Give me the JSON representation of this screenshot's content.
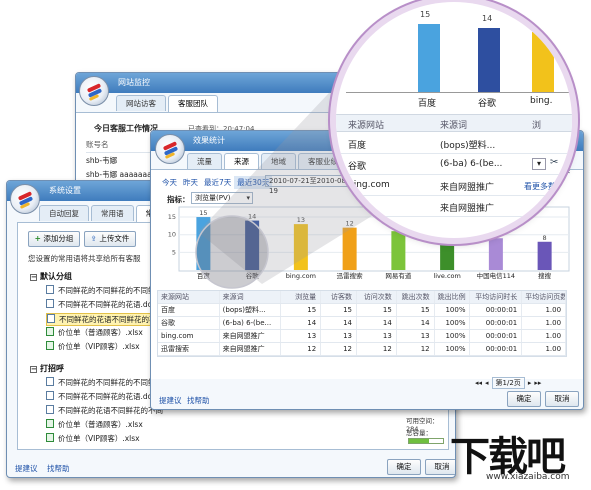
{
  "monitor": {
    "title": "网站监控",
    "tabs": [
      "网站访客",
      "客服团队"
    ],
    "heading": "今日客服工作情况",
    "stats_label": "已查看到：20:47:04",
    "col_label": "账号名",
    "rows": [
      "shb-韦娜",
      "shb-韦娜 aaaaaaaaaaaa"
    ]
  },
  "settings": {
    "title": "系统设置",
    "tabs": [
      "自动回复",
      "常用语",
      "常用文件"
    ],
    "add_group": "添加分组",
    "upload": "上传文件",
    "notice": "您设置的常用语将共享给所有客服",
    "groups": [
      {
        "name": "默认分组",
        "files": [
          "不同鲜花的不同鲜花的不同鲜",
          "不同鲜花不同鲜花的花语.docx",
          "不同鲜花的花语不同鲜花的不同",
          "价位单（普通顾客）.xlsx",
          "价位单（VIP顾客）.xlsx"
        ]
      },
      {
        "name": "打招呼",
        "files": [
          "不同鲜花的不同鲜花的不同鲜花",
          "不同鲜花不同鲜花的花语.docx",
          "不同鲜花的花语不同鲜花的不同",
          "价位单（普通顾客）.xlsx",
          "价位单（VIP顾客）.xlsx"
        ]
      }
    ],
    "usage_label": "可用空间：284",
    "capacity_label": "总容量：",
    "feedback": "提建议",
    "help": "找帮助",
    "ok": "确定",
    "cancel": "取消"
  },
  "stats": {
    "title": "效果统计",
    "tabs": [
      "流量",
      "来源",
      "地域",
      "客服业绩"
    ],
    "range_links": [
      "今天",
      "昨天",
      "最近7天",
      "最近30天"
    ],
    "date_range": "2010-07-21至2010-08-19",
    "metric_label": "指标：",
    "metric_value": "浏览量(PV)",
    "table_headers": [
      "来源网站",
      "来源词",
      "浏览量",
      "访客数",
      "访问次数",
      "跳出次数",
      "跳出比例",
      "平均访问时长",
      "平均访问页数"
    ],
    "table_rows": [
      [
        "百度",
        "(bops)塑料...",
        "15",
        "15",
        "15",
        "15",
        "100%",
        "00:00:01",
        "1.00"
      ],
      [
        "谷歌",
        "(6-ba) 6-(be...",
        "14",
        "14",
        "14",
        "14",
        "100%",
        "00:00:01",
        "1.00"
      ],
      [
        "bing.com",
        "来自网盟推广",
        "13",
        "13",
        "13",
        "13",
        "100%",
        "00:00:01",
        "1.00"
      ],
      [
        "迅雷搜索",
        "来自网盟推广",
        "12",
        "12",
        "12",
        "12",
        "100%",
        "00:00:01",
        "1.00"
      ]
    ],
    "pagination": "第1/2页",
    "feedback": "提建议",
    "help": "找帮助",
    "ok": "确定",
    "cancel": "取消"
  },
  "chart_data": {
    "type": "bar",
    "categories": [
      "百度",
      "谷歌",
      "bing.com",
      "迅雷搜索",
      "网易有道",
      "live.com",
      "中国电信114",
      "搜搜"
    ],
    "values": [
      15,
      14,
      13,
      12,
      11,
      10,
      9,
      8
    ],
    "colors": [
      "#4aa3df",
      "#2e4fa0",
      "#f2c21b",
      "#f0a018",
      "#7cc43a",
      "#3d8f2a",
      "#a98ad6",
      "#6a56b8"
    ],
    "yticks": [
      5,
      10,
      15
    ],
    "ylim": [
      0,
      17
    ]
  },
  "zoom": {
    "values": [
      "15",
      "14"
    ],
    "categories": [
      "百度",
      "谷歌",
      "bing."
    ],
    "headers": [
      "来源网站",
      "来源词",
      "浏"
    ],
    "rows": [
      [
        "百度",
        "(bops)塑料..."
      ],
      [
        "谷歌",
        "(6-ba) 6-(be..."
      ],
      [
        "bing.com",
        "来自网盟推广"
      ],
      [
        "",
        "来自网盟推广"
      ]
    ],
    "more_link": "看更多数据"
  },
  "watermark": {
    "brand": "下载吧",
    "url": "www.xiazaiba.com"
  }
}
